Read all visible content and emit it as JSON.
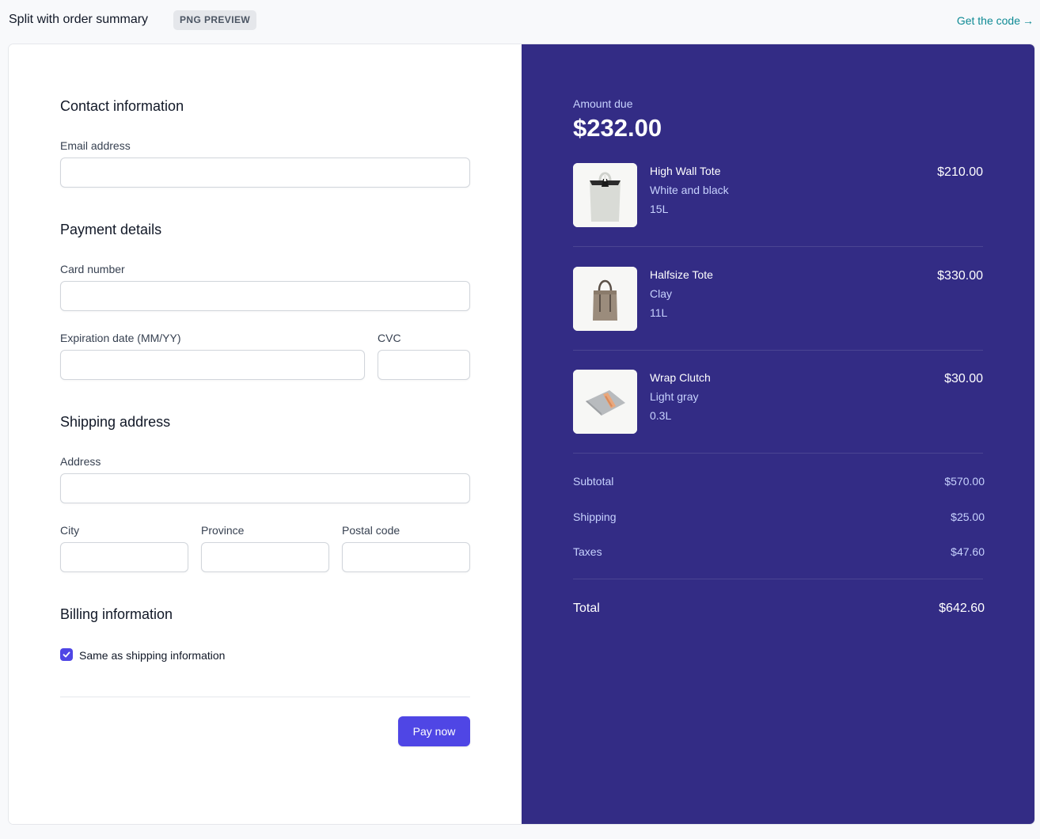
{
  "header": {
    "title": "Split with order summary",
    "badge": "PNG PREVIEW",
    "get_code": "Get the code",
    "get_code_arrow": "→"
  },
  "form": {
    "contact": {
      "title": "Contact information",
      "email_label": "Email address",
      "email_value": ""
    },
    "payment": {
      "title": "Payment details",
      "card_label": "Card number",
      "card_value": "",
      "exp_label": "Expiration date (MM/YY)",
      "exp_value": "",
      "cvc_label": "CVC",
      "cvc_value": ""
    },
    "shipping": {
      "title": "Shipping address",
      "address_label": "Address",
      "address_value": "",
      "city_label": "City",
      "city_value": "",
      "province_label": "Province",
      "province_value": "",
      "postal_label": "Postal code",
      "postal_value": ""
    },
    "billing": {
      "title": "Billing information",
      "same_as_shipping_label": "Same as shipping information",
      "same_as_shipping_checked": true
    },
    "pay_button": "Pay now"
  },
  "summary": {
    "amount_due_label": "Amount due",
    "amount_due_value": "$232.00",
    "items": [
      {
        "name": "High Wall Tote",
        "variant": "White and black",
        "size": "15L",
        "price": "$210.00",
        "image": "white-tote-bag"
      },
      {
        "name": "Halfsize Tote",
        "variant": "Clay",
        "size": "11L",
        "price": "$330.00",
        "image": "clay-tote-bag"
      },
      {
        "name": "Wrap Clutch",
        "variant": "Light gray",
        "size": "0.3L",
        "price": "$30.00",
        "image": "gray-clutch"
      }
    ],
    "subtotal_label": "Subtotal",
    "subtotal_value": "$570.00",
    "shipping_label": "Shipping",
    "shipping_value": "$25.00",
    "taxes_label": "Taxes",
    "taxes_value": "$47.60",
    "total_label": "Total",
    "total_value": "$642.60"
  },
  "colors": {
    "accent": "#4f46e5",
    "summary_bg": "#332c85",
    "summary_muted_text": "#c7d2fe",
    "link": "#0e8a94"
  }
}
